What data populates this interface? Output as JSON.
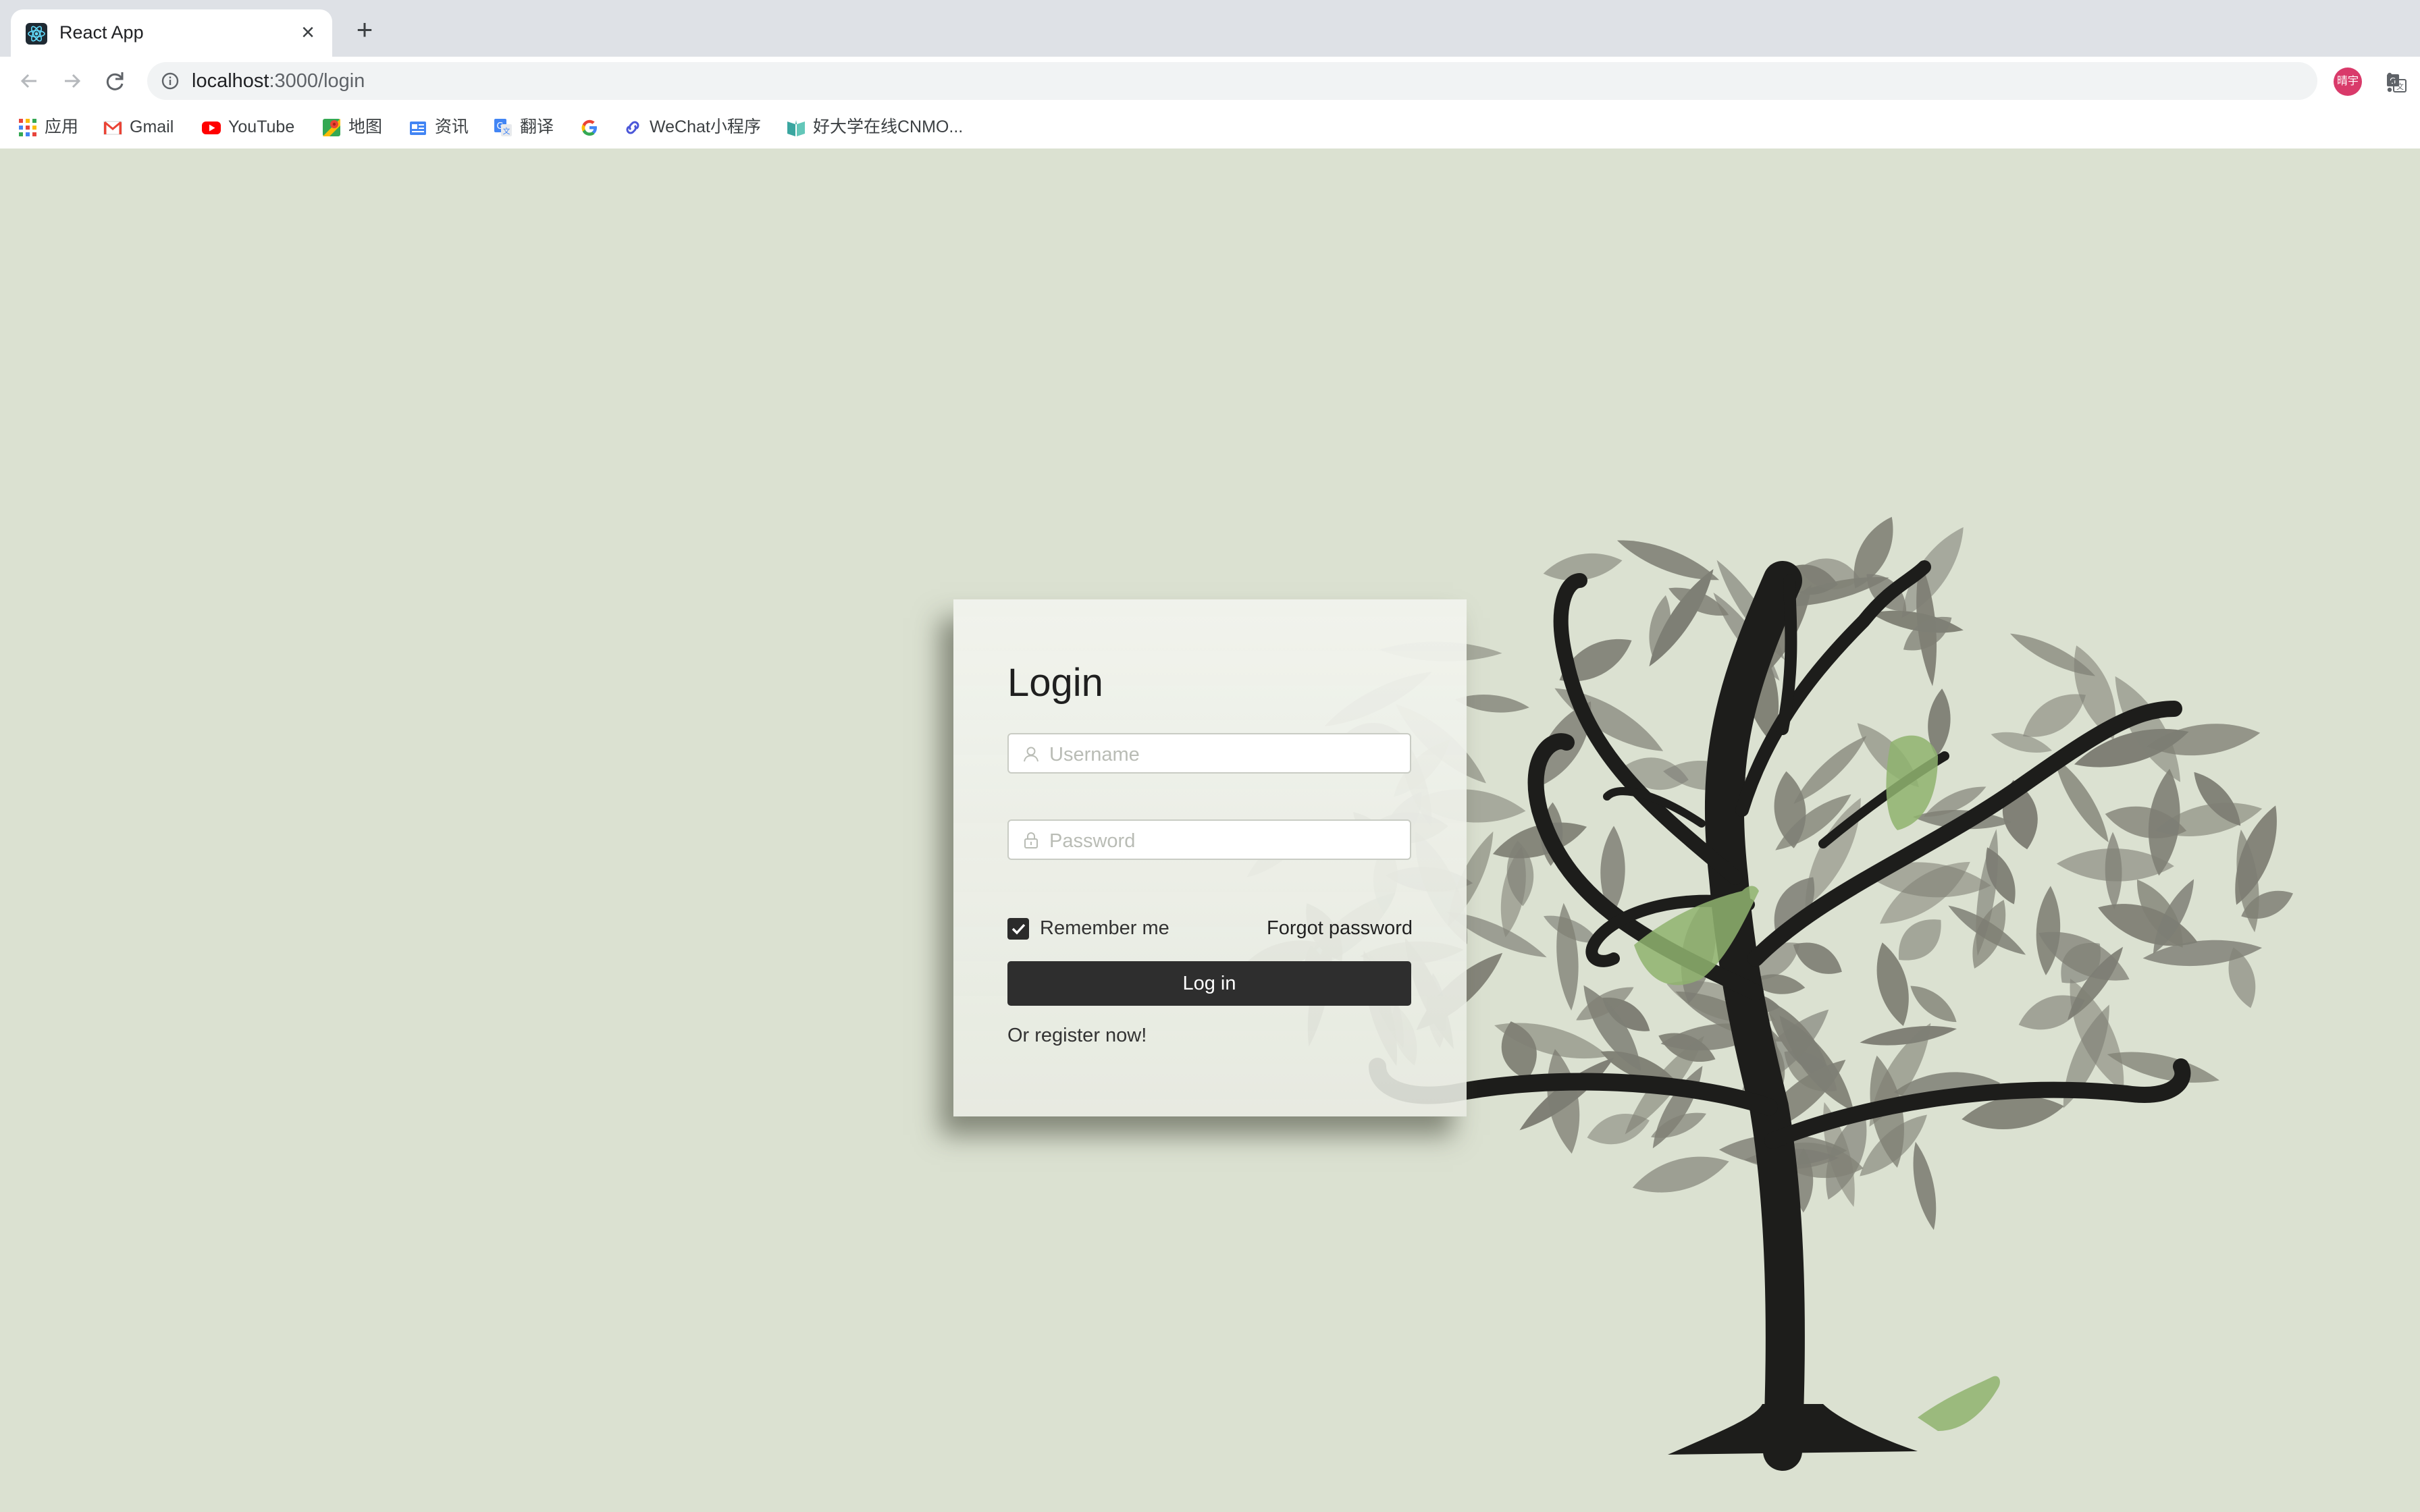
{
  "browser": {
    "tab_title": "React App",
    "close_glyph": "×",
    "new_tab_glyph": "+",
    "url_host": "localhost",
    "url_path": ":3000/login",
    "profile_initials": "晴宇",
    "bookmarks": [
      {
        "label": "应用",
        "icon": "apps-grid-icon"
      },
      {
        "label": "Gmail",
        "icon": "gmail-icon"
      },
      {
        "label": "YouTube",
        "icon": "youtube-icon"
      },
      {
        "label": "地图",
        "icon": "maps-icon"
      },
      {
        "label": "资讯",
        "icon": "news-icon"
      },
      {
        "label": "翻译",
        "icon": "translate-icon"
      },
      {
        "label": "",
        "icon": "google-icon"
      },
      {
        "label": "WeChat小程序",
        "icon": "link-icon"
      },
      {
        "label": "好大学在线CNMO...",
        "icon": "book-icon"
      }
    ]
  },
  "login": {
    "title": "Login",
    "username_placeholder": "Username",
    "password_placeholder": "Password",
    "remember_label": "Remember me",
    "remember_checked": true,
    "forgot_label": "Forgot password",
    "submit_label": "Log in",
    "register_label": "Or register now!"
  },
  "colors": {
    "page_background": "#dbe1d1",
    "button": "#2e2e2e",
    "leaf": "#7a7a70",
    "trunk": "#1d1d1b",
    "bird": "#8fb36f"
  }
}
